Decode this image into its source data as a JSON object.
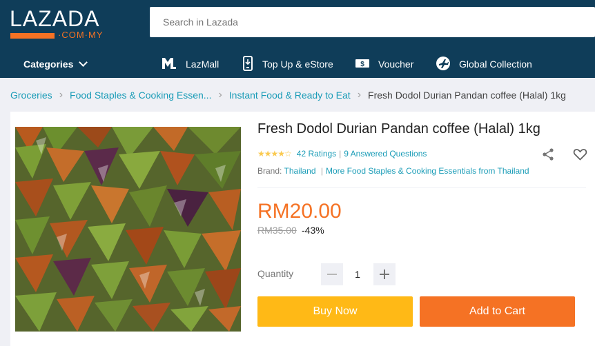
{
  "header": {
    "logo_text": "LAZADA",
    "logo_sub": "·COM·MY",
    "search_placeholder": "Search in Lazada",
    "categories_label": "Categories",
    "nav": [
      {
        "label": "LazMall",
        "icon": "lazmall-icon"
      },
      {
        "label": "Top Up & eStore",
        "icon": "phone-icon"
      },
      {
        "label": "Voucher",
        "icon": "voucher-icon"
      },
      {
        "label": "Global Collection",
        "icon": "plane-icon"
      }
    ]
  },
  "breadcrumb": {
    "items": [
      "Groceries",
      "Food Staples & Cooking Essen...",
      "Instant Food & Ready to Eat"
    ],
    "current": "Fresh Dodol Durian Pandan coffee (Halal) 1kg"
  },
  "product": {
    "title": "Fresh Dodol Durian Pandan coffee (Halal) 1kg",
    "ratings_text": "42 Ratings",
    "questions_text": "9 Answered Questions",
    "rating_value": 4.5,
    "brand_label": "Brand:",
    "brand_value": "Thailand",
    "more_link": "More Food Staples & Cooking Essentials from Thailand",
    "price": "RM20.00",
    "original_price": "RM35.00",
    "discount": "-43%",
    "quantity_label": "Quantity",
    "quantity": "1",
    "buy_now": "Buy Now",
    "add_to_cart": "Add to Cart"
  },
  "colors": {
    "header_bg": "#0f3d59",
    "accent": "#f57224",
    "buy_now": "#ffb916",
    "link": "#1a9cb7"
  }
}
